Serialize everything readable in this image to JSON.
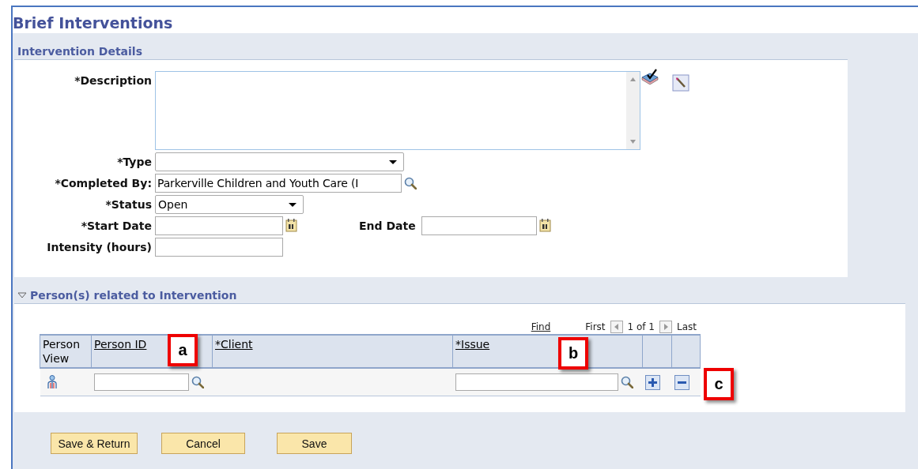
{
  "page": {
    "title": "Brief Interventions"
  },
  "details": {
    "title": "Intervention Details",
    "fields": [
      {
        "kind": "textarea",
        "label": "*Description"
      },
      {
        "kind": "select",
        "label": "*Type"
      },
      {
        "kind": "lookup",
        "label": "*Completed By:",
        "value": "Parkerville Children and Youth Care (I"
      },
      {
        "kind": "select",
        "label": "*Status",
        "value": "Open"
      },
      {
        "kind": "daterange",
        "label": "*Start Date",
        "label2": "End Date"
      },
      {
        "kind": "text",
        "label": "Intensity (hours)"
      }
    ]
  },
  "persons": {
    "title": "Person(s) related to Intervention",
    "expanded": true,
    "nav": {
      "find": "Find",
      "first": "First",
      "count": "1 of 1",
      "last": "Last"
    },
    "columns": [
      {
        "label": "Person View",
        "sortable": false
      },
      {
        "label": "Person ID",
        "sortable": true
      },
      {
        "label": "*Client",
        "sortable": true
      },
      {
        "label": "*Issue",
        "sortable": true
      }
    ],
    "rows": [
      {}
    ]
  },
  "buttons": [
    "Save & Return",
    "Cancel",
    "Save"
  ],
  "callouts": [
    "a",
    "b",
    "c"
  ]
}
